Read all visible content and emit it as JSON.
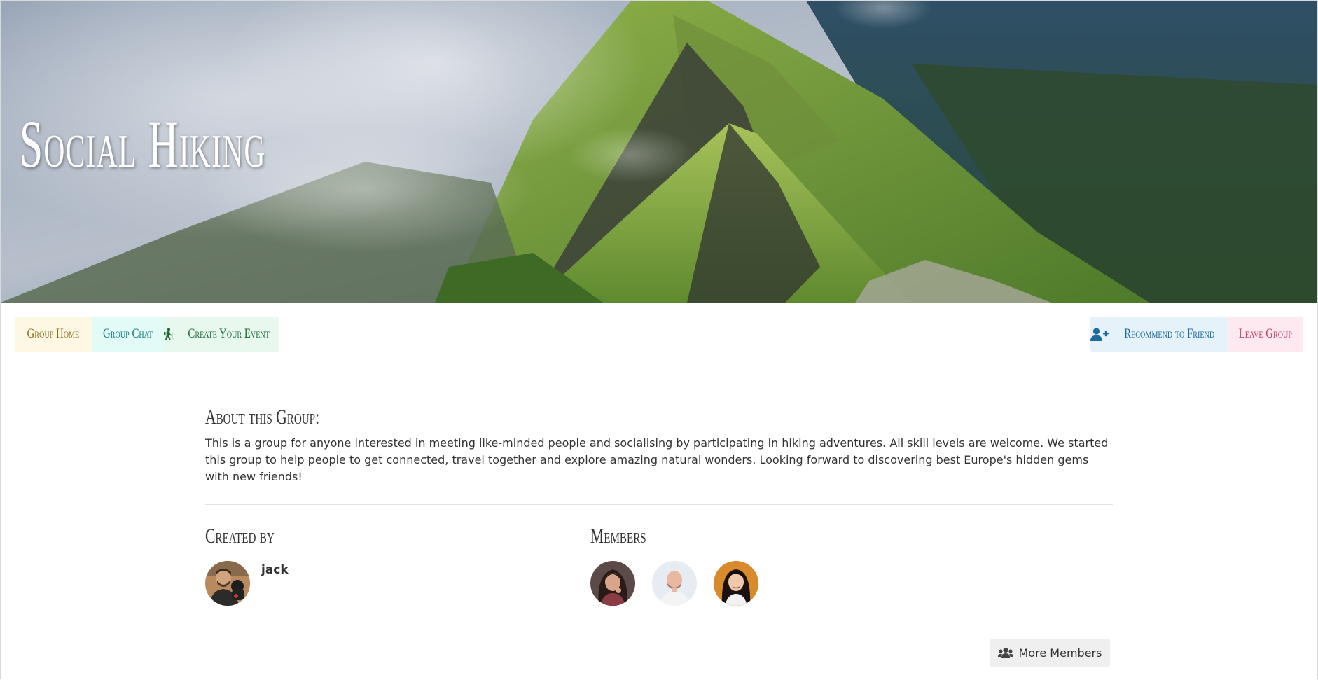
{
  "hero": {
    "title": "Social Hiking",
    "image": "mountain-ridge-landscape"
  },
  "toolbar": {
    "left": [
      {
        "label": "Group Home",
        "icon": null
      },
      {
        "label": "Group Chat",
        "icon": null
      },
      {
        "label": "Create Your Event",
        "icon": "hiking-icon"
      }
    ],
    "right": [
      {
        "label": "Recommend to Friend",
        "icon": "user-plus-icon"
      },
      {
        "label": "Leave Group",
        "icon": null
      }
    ]
  },
  "about": {
    "heading": "About this Group:",
    "text": "This is a group for anyone interested in meeting like-minded people and socialising by participating in hiking adventures. All skill levels are welcome. We started this group to help people to get connected, travel together and explore amazing natural wonders. Looking forward to discovering best Europe's hidden gems with new friends!"
  },
  "created_by": {
    "heading": "Created by",
    "name": "jack"
  },
  "members": {
    "heading": "Members",
    "more_label": "More Members",
    "more_icon": "users-icon"
  },
  "colors": {
    "home_bg": "#fdf8e4",
    "home_fg": "#8a6a1b",
    "chat_bg": "#e3fbf6",
    "chat_fg": "#157a78",
    "event_bg": "#e9f8ee",
    "event_fg": "#1e6a38",
    "recommend_bg": "#e5f2fa",
    "recommend_fg": "#1e6a9a",
    "leave_bg": "#fde9ef",
    "leave_fg": "#c23a60"
  }
}
